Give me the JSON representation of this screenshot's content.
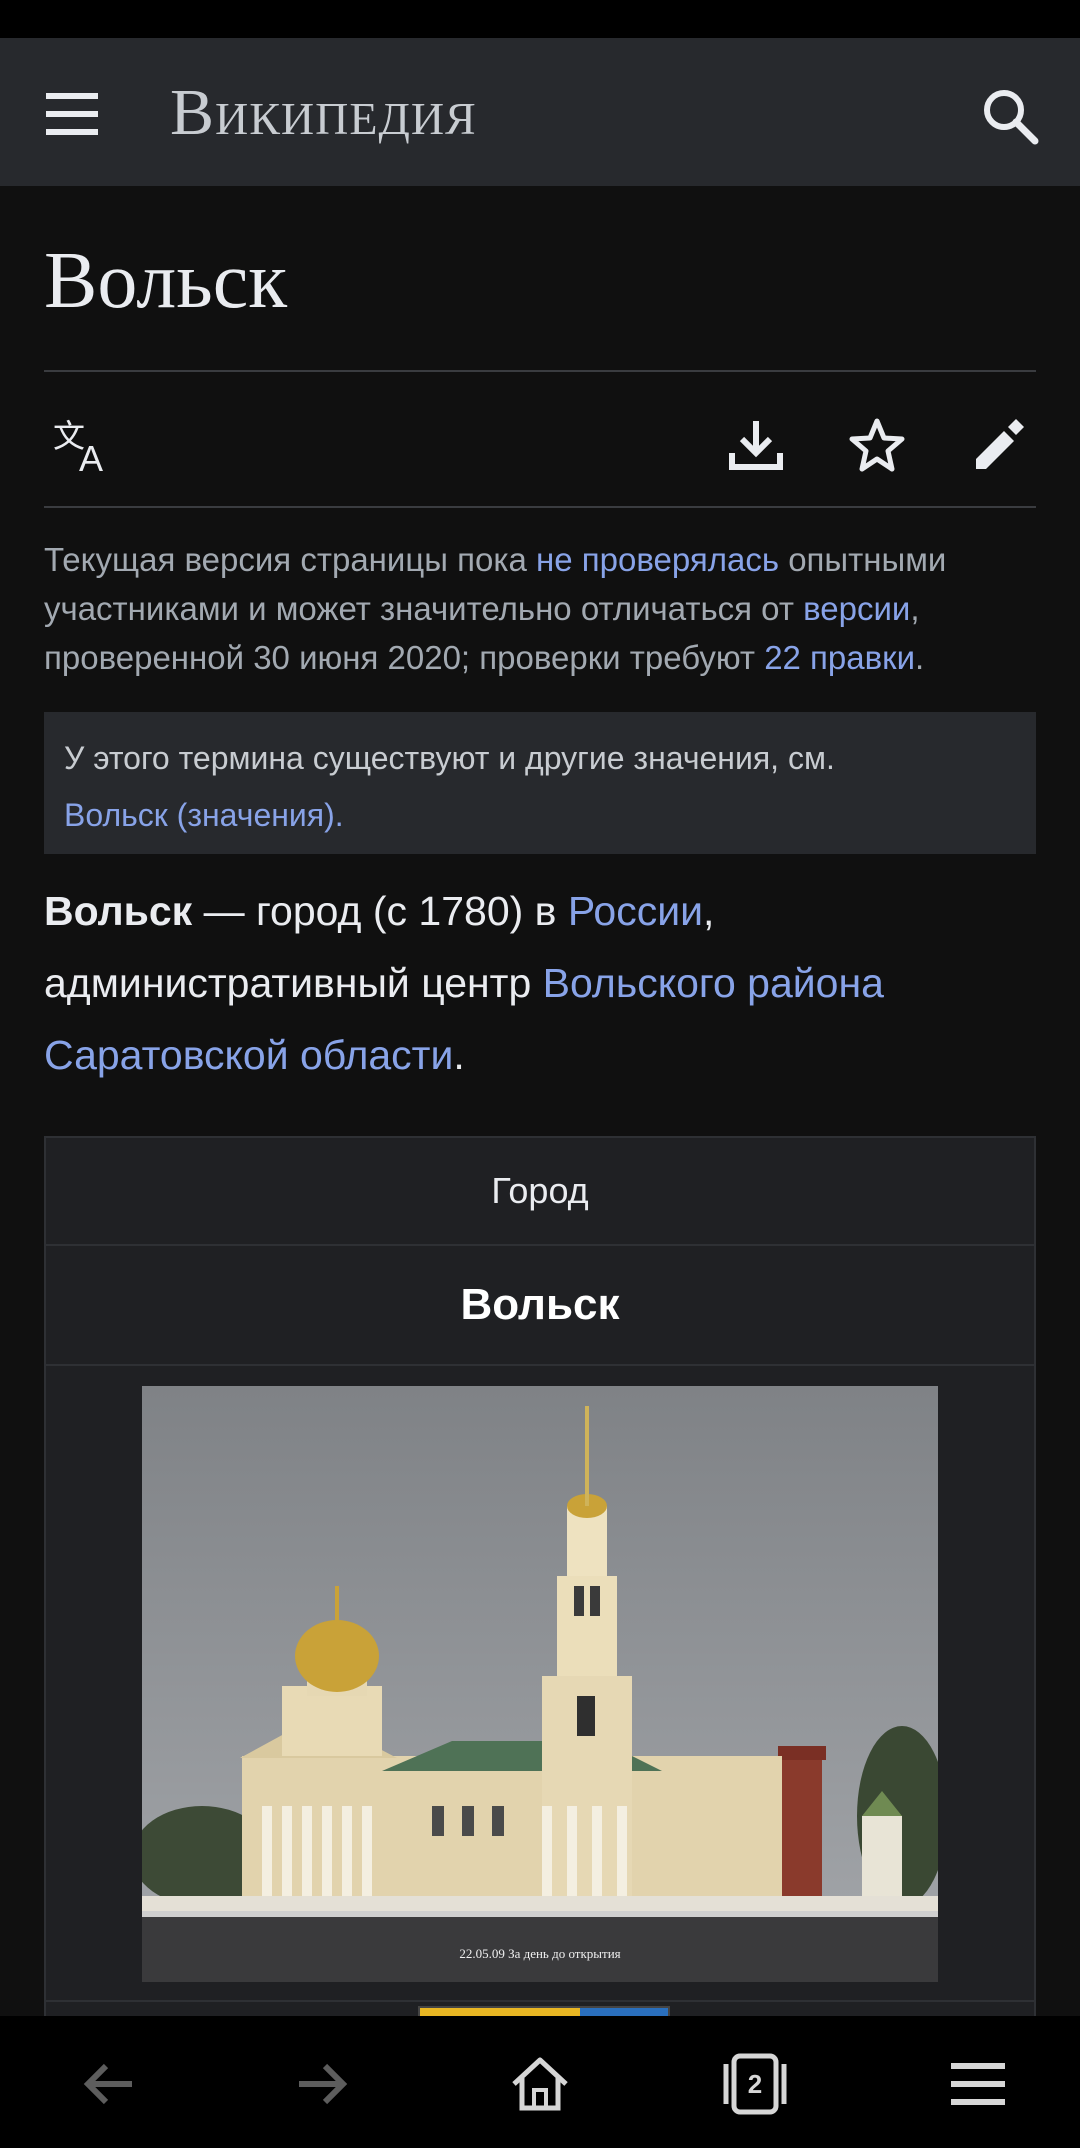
{
  "header": {
    "wordmark": "Википедия",
    "icons": {
      "menu": "hamburger-menu-icon",
      "search": "search-icon"
    }
  },
  "article": {
    "title": "Вольск",
    "actions": [
      "language-icon",
      "download-icon",
      "star-icon",
      "edit-pencil-icon"
    ],
    "notice": {
      "part1": "Текущая версия страницы пока ",
      "link1": "не проверялась",
      "part2": " опытными участниками и может значительно отличаться от ",
      "link2": "версии",
      "part3": ", проверенной 30 июня 2020; проверки требуют ",
      "link3": "22 правки",
      "part4": "."
    },
    "hatnote": {
      "text": "У этого термина существуют и другие значения, см.",
      "link": "Вольск (значения)."
    },
    "lead": {
      "bold": "Вольск",
      "part1": " — город (с 1780) в ",
      "link1": "России",
      "part2": ", административный центр ",
      "link2": "Вольского района Саратовской области",
      "part3": "."
    },
    "infobox": {
      "type": "Город",
      "name": "Вольск",
      "photo_caption": "22.05.09 За день до открытия"
    }
  },
  "bottom_nav": {
    "tab_count": "2",
    "icons": [
      "back-arrow-icon",
      "forward-arrow-icon",
      "home-icon",
      "tabs-icon",
      "menu-icon"
    ]
  },
  "colors": {
    "background": "#101010",
    "header": "#27292d",
    "link": "#88a3e8",
    "muted_text": "#a2a9b1",
    "text": "#eaecf0"
  }
}
